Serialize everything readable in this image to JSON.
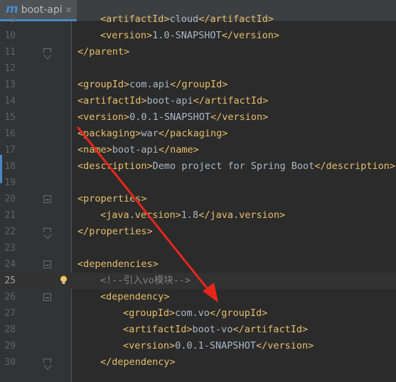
{
  "tab": {
    "icon": "m",
    "title": "boot-api",
    "close": "×"
  },
  "lines": [
    {
      "num": "9",
      "indent": 1,
      "tag_open": "<artifactId>",
      "text": "cloud",
      "tag_close": "</artifactId>",
      "partial": true
    },
    {
      "num": "10",
      "indent": 1,
      "tag_open": "<version>",
      "text": "1.0-SNAPSHOT",
      "tag_close": "</version>"
    },
    {
      "num": "11",
      "indent": 0,
      "tag_open": "</parent>",
      "text": "",
      "tag_close": ""
    },
    {
      "num": "12",
      "indent": 0,
      "tag_open": "",
      "text": "",
      "tag_close": ""
    },
    {
      "num": "13",
      "indent": 0,
      "tag_open": "<groupId>",
      "text": "com.api",
      "tag_close": "</groupId>"
    },
    {
      "num": "14",
      "indent": 0,
      "tag_open": "<artifactId>",
      "text": "boot-api",
      "tag_close": "</artifactId>"
    },
    {
      "num": "15",
      "indent": 0,
      "tag_open": "<version>",
      "text": "0.0.1-SNAPSHOT",
      "tag_close": "</version>"
    },
    {
      "num": "16",
      "indent": 0,
      "tag_open": "<packaging>",
      "text": "war",
      "tag_close": "</packaging>"
    },
    {
      "num": "17",
      "indent": 0,
      "tag_open": "<name>",
      "text": "boot-api",
      "tag_close": "</name>"
    },
    {
      "num": "18",
      "indent": 0,
      "tag_open": "<description>",
      "text": "Demo project for Spring Boot",
      "tag_close": "</description>"
    },
    {
      "num": "19",
      "indent": 0,
      "tag_open": "",
      "text": "",
      "tag_close": ""
    },
    {
      "num": "20",
      "indent": 0,
      "tag_open": "<properties>",
      "text": "",
      "tag_close": ""
    },
    {
      "num": "21",
      "indent": 1,
      "tag_open": "<java.version>",
      "text": "1.8",
      "tag_close": "</java.version>"
    },
    {
      "num": "22",
      "indent": 0,
      "tag_open": "</properties>",
      "text": "",
      "tag_close": ""
    },
    {
      "num": "23",
      "indent": 0,
      "tag_open": "",
      "text": "",
      "tag_close": ""
    },
    {
      "num": "24",
      "indent": 0,
      "tag_open": "<dependencies>",
      "text": "",
      "tag_close": ""
    },
    {
      "num": "25",
      "indent": 1,
      "comment": "<!--引入vo模块-->"
    },
    {
      "num": "26",
      "indent": 1,
      "tag_open": "<dependency>",
      "text": "",
      "tag_close": ""
    },
    {
      "num": "27",
      "indent": 2,
      "tag_open": "<groupId>",
      "text": "com.vo",
      "tag_close": "</groupId>"
    },
    {
      "num": "28",
      "indent": 2,
      "tag_open": "<artifactId>",
      "text": "boot-vo",
      "tag_close": "</artifactId>"
    },
    {
      "num": "29",
      "indent": 2,
      "tag_open": "<version>",
      "text": "0.0.1-SNAPSHOT",
      "tag_close": "</version>"
    },
    {
      "num": "30",
      "indent": 1,
      "tag_open": "</dependency>",
      "text": "",
      "tag_close": ""
    }
  ],
  "current_line": "25",
  "colors": {
    "background": "#2b2b2b",
    "tag": "#e8bf6a",
    "text": "#a9b7c6",
    "comment": "#808080",
    "arrow": "#e8261c"
  },
  "icons": {
    "tab": "maven-module-icon",
    "intention": "lightbulb-icon",
    "fold": "fold-marker-icon"
  }
}
